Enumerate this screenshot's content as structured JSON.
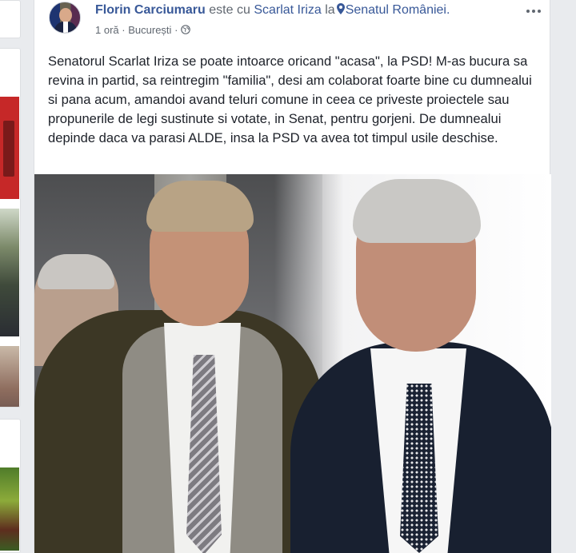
{
  "post": {
    "author": "Florin Carciumaru",
    "with_text": "este cu",
    "tagged": "Scarlat Iriza",
    "at_text": "la",
    "location": "Senatul României.",
    "time": "1 oră",
    "separator": "·",
    "city": "București",
    "separator2": "·",
    "text": "Senatorul Scarlat Iriza se poate intoarce oricand \"acasa\", la PSD! M-as bucura sa revina in partid, sa reintregim \"familia\", desi am colaborat foarte bine cu dumnealui si pana acum, amandoi avand teluri comune in ceea ce priveste proiectele sau propunerile de legi sustinute si votate, in Senat, pentru gorjeni. De dumnealui depinde daca va parasi ALDE, insa la PSD va avea tot timpul usile deschise."
  },
  "icons": {
    "location": "map-pin-icon",
    "audience": "globe-icon",
    "menu": "more-options-icon"
  },
  "colors": {
    "link": "#385898",
    "text": "#1d2129",
    "muted": "#606770",
    "page_bg": "#e9ebee"
  }
}
